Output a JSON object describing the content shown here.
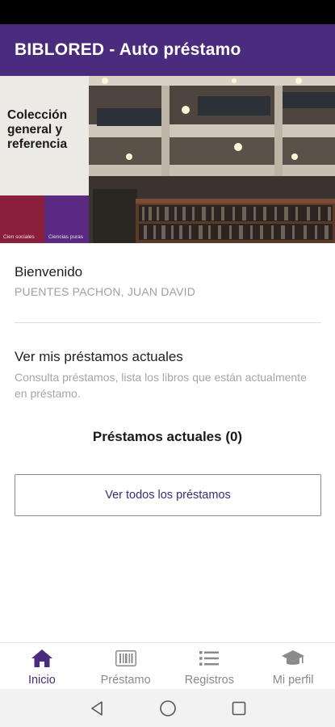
{
  "app": {
    "title": "BIBLORED - Auto préstamo"
  },
  "hero": {
    "sign_text": "Colección general y referencia",
    "label_left": "Cien sociales",
    "label_right": "Ciencias puras"
  },
  "welcome": {
    "title": "Bienvenido",
    "user_name": "PUENTES PACHON, JUAN DAVID"
  },
  "loans_section": {
    "title": "Ver mis préstamos actuales",
    "description": "Consulta préstamos, lista los libros que están actualmente en préstamo.",
    "count_label": "Préstamos actuales (0)",
    "view_all_label": "Ver todos los préstamos"
  },
  "bottom_nav": {
    "items": [
      {
        "label": "Inicio",
        "icon": "home-icon",
        "active": true
      },
      {
        "label": "Préstamo",
        "icon": "barcode-icon",
        "active": false
      },
      {
        "label": "Registros",
        "icon": "list-icon",
        "active": false
      },
      {
        "label": "Mi perfil",
        "icon": "graduation-cap-icon",
        "active": false
      }
    ]
  },
  "colors": {
    "primary": "#4a2b7e",
    "button_text": "#3d2a78",
    "inactive": "#8a8a8a"
  }
}
